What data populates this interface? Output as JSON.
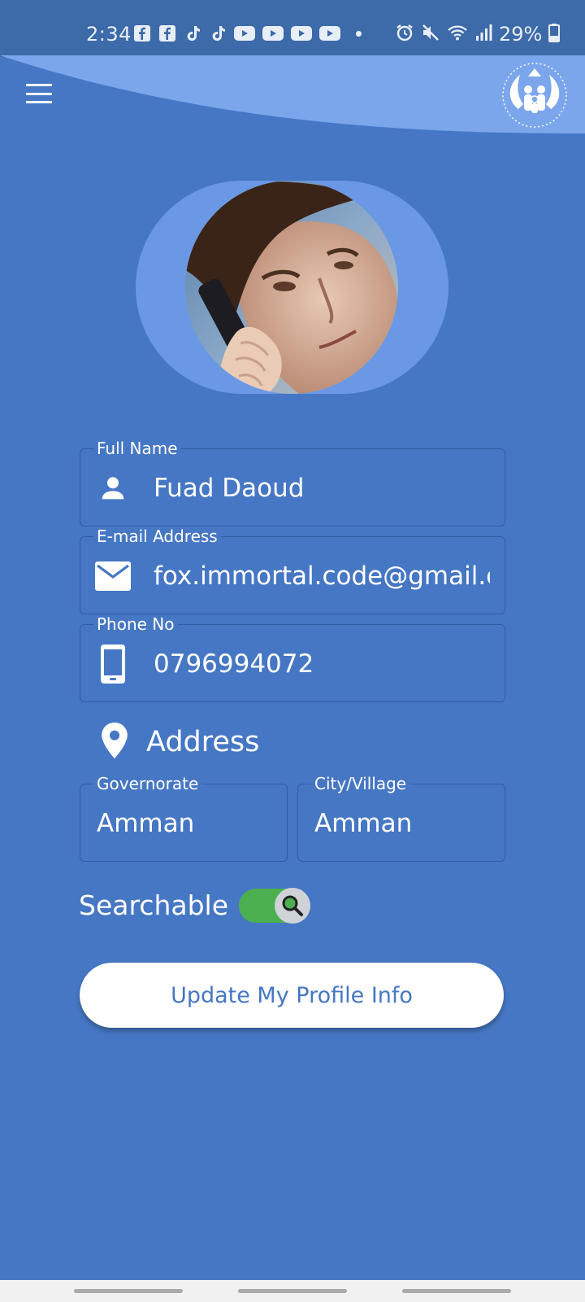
{
  "status_bar": {
    "time": "2:34",
    "battery": "29%",
    "notification_icons": [
      "facebook-icon",
      "facebook-icon",
      "tiktok-icon",
      "tiktok-icon",
      "youtube-icon",
      "youtube-icon",
      "youtube-icon",
      "youtube-icon"
    ],
    "system_icons": [
      "alarm-icon",
      "mute-icon",
      "wifi-icon",
      "signal-icon",
      "battery-icon"
    ]
  },
  "header": {
    "menu_icon": "hamburger-menu-icon",
    "logo_icon": "family-protection-logo"
  },
  "profile": {
    "avatar": "profile-photo"
  },
  "form": {
    "full_name": {
      "label": "Full Name",
      "value": "Fuad Daoud",
      "icon": "person-icon"
    },
    "email": {
      "label": "E-mail Address",
      "value": "fox.immortal.code@gmail.com",
      "icon": "mail-icon"
    },
    "phone": {
      "label": "Phone No",
      "value": "0796994072",
      "icon": "smartphone-icon"
    },
    "address_heading": "Address",
    "address_icon": "location-pin-icon",
    "governorate": {
      "label": "Governorate",
      "value": "Amman"
    },
    "city": {
      "label": "City/Village",
      "value": "Amman"
    },
    "searchable": {
      "label": "Searchable",
      "enabled": true,
      "icon": "search-icon"
    },
    "update_button": "Update My Profile Info"
  },
  "colors": {
    "background": "#4677c4",
    "status_bar": "#3d6aa8",
    "header_wave": "#7ba6ec",
    "avatar_bg": "#6a98e4",
    "toggle_on": "#4caf50",
    "button_bg": "#ffffff",
    "button_text": "#4677c4"
  }
}
